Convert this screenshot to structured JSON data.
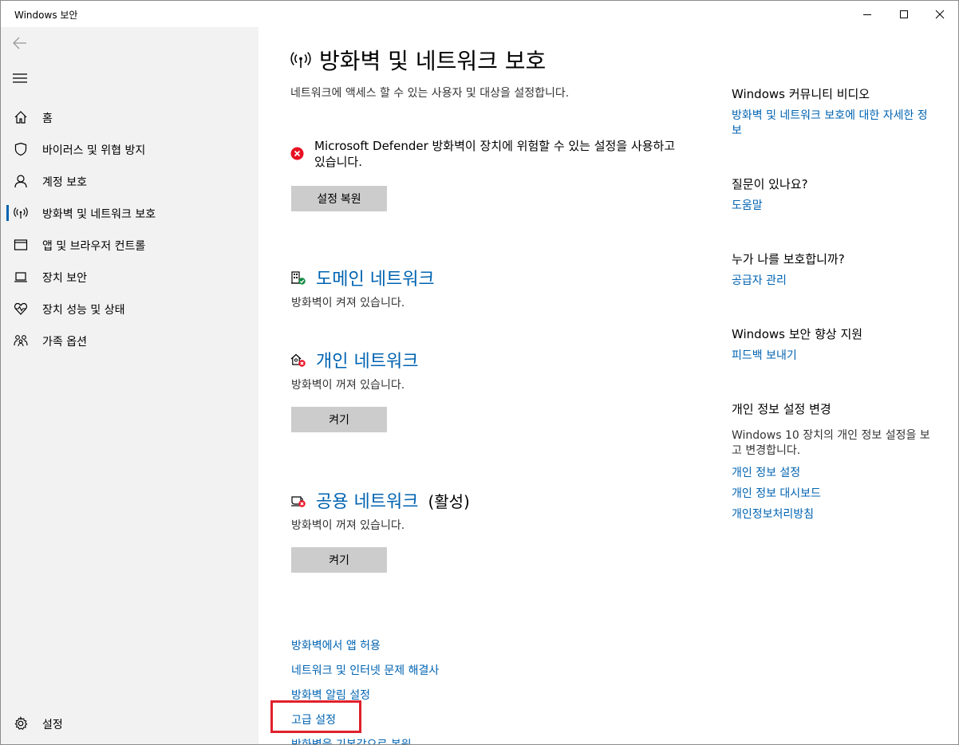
{
  "window": {
    "title": "Windows 보안"
  },
  "sidebar": {
    "items": [
      {
        "label": "홈",
        "icon": "home-icon"
      },
      {
        "label": "바이러스 및 위협 방지",
        "icon": "shield-icon"
      },
      {
        "label": "계정 보호",
        "icon": "person-icon"
      },
      {
        "label": "방화벽 및 네트워크 보호",
        "icon": "antenna-icon",
        "active": true
      },
      {
        "label": "앱 및 브라우저 컨트롤",
        "icon": "browser-window-icon"
      },
      {
        "label": "장치 보안",
        "icon": "laptop-icon"
      },
      {
        "label": "장치 성능 및 상태",
        "icon": "heart-pulse-icon"
      },
      {
        "label": "가족 옵션",
        "icon": "family-icon"
      }
    ],
    "settings_label": "설정"
  },
  "main": {
    "title": "방화벽 및 네트워크 보호",
    "subtitle": "네트워크에 액세스 할 수 있는 사용자 및 대상을 설정합니다.",
    "alert": {
      "text": "Microsoft Defender 방화벽이 장치에 위험할 수 있는 설정을 사용하고 있습니다.",
      "button": "설정 복원"
    },
    "networks": {
      "domain": {
        "name": "도메인 네트워크",
        "status": "방화벽이 켜져 있습니다."
      },
      "private": {
        "name": "개인 네트워크",
        "status": "방화벽이 꺼져 있습니다.",
        "button": "켜기"
      },
      "public": {
        "name": "공용 네트워크",
        "suffix": "(활성)",
        "status": "방화벽이 꺼져 있습니다.",
        "button": "켜기"
      }
    },
    "links": {
      "allow_app": "방화벽에서 앱 허용",
      "troubleshooter": "네트워크 및 인터넷 문제 해결사",
      "notifications": "방화벽 알림 설정",
      "advanced": "고급 설정",
      "restore_defaults": "방화벽을 기본값으로 복원"
    }
  },
  "right_panel": {
    "community": {
      "heading": "Windows 커뮤니티 비디오",
      "link": "방화벽 및 네트워크 보호에 대한 자세한 정보"
    },
    "question": {
      "heading": "질문이 있나요?",
      "link": "도움말"
    },
    "protector": {
      "heading": "누가 나를 보호합니까?",
      "link": "공급자 관리"
    },
    "improve": {
      "heading": "Windows 보안 향상 지원",
      "link": "피드백 보내기"
    },
    "privacy": {
      "heading": "개인 정보 설정 변경",
      "text": "Windows 10 장치의 개인 정보 설정을 보고 변경합니다.",
      "links": [
        "개인 정보 설정",
        "개인 정보 대시보드",
        "개인정보처리방침"
      ]
    }
  },
  "colors": {
    "accent": "#0063b1",
    "sidebar_bg": "#f2f2f2",
    "button_bg": "#cccccc",
    "error": "#e81123",
    "ok": "#10893e",
    "highlight": "#e0202c"
  }
}
